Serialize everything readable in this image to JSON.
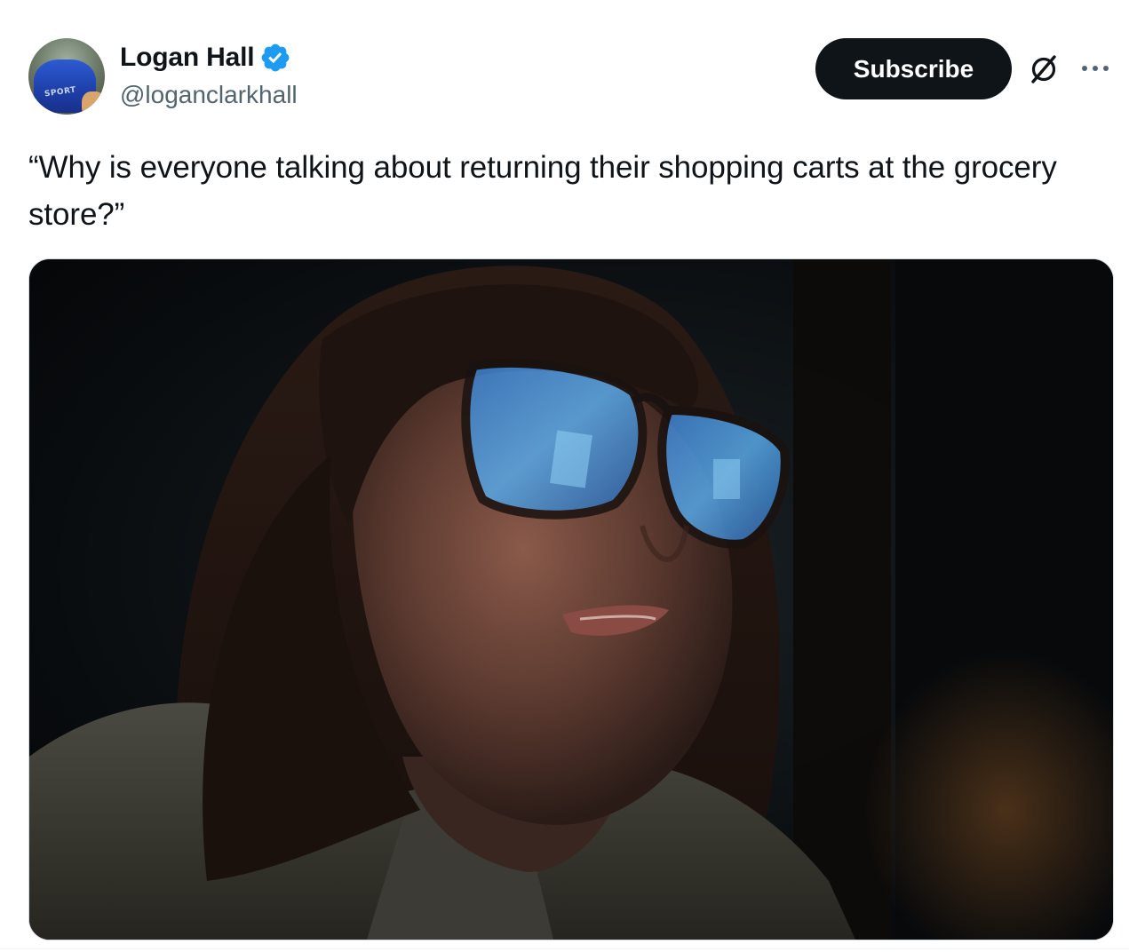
{
  "tweet": {
    "author": {
      "display_name": "Logan Hall",
      "handle": "@loganclarkhall",
      "verified": true,
      "avatar_text": "SPORT"
    },
    "subscribe_label": "Subscribe",
    "icons": {
      "verified": "verified-badge-icon",
      "grok": "grok-icon",
      "more": "more-options-icon"
    },
    "text": "“Why is everyone talking about returning their shopping carts at the grocery store?”",
    "media": {
      "type": "image",
      "alt": ""
    }
  },
  "colors": {
    "primary_text": "#0f1419",
    "secondary_text": "#536471",
    "verified_blue": "#1d9bf0",
    "button_bg": "#0f1419",
    "border": "#cfd9de"
  }
}
